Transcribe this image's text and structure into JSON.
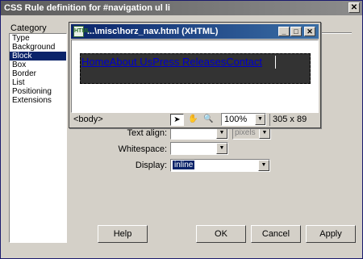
{
  "dialog": {
    "title": "CSS Rule definition for #navigation ul li",
    "close_glyph": "✕"
  },
  "category": {
    "label": "Category",
    "items": [
      "Type",
      "Background",
      "Block",
      "Box",
      "Border",
      "List",
      "Positioning",
      "Extensions"
    ],
    "selected": "Block"
  },
  "fields": {
    "text_align_label": "Text align:",
    "whitespace_label": "Whitespace:",
    "whitespace_value": "",
    "display_label": "Display:",
    "display_value": "inline",
    "text_align_unit": "pixels"
  },
  "buttons": {
    "help": "Help",
    "ok": "OK",
    "cancel": "Cancel",
    "apply": "Apply"
  },
  "preview": {
    "title": "...\\misc\\horz_nav.html (XHTML)",
    "nav_text": "HomeAbout UsPress ReleasesContact",
    "tag_selector": "<body>",
    "zoom": "100%",
    "dimensions": "305 x 89",
    "icon_text": "HTML",
    "minimize_glyph": "_",
    "maximize_glyph": "□",
    "close_glyph": "✕",
    "tools": {
      "select": "➤",
      "hand": "✋",
      "zoom": "🔍"
    }
  },
  "colors": {
    "selection": "#0a246a",
    "nav_bg": "#333333",
    "link": "#0000cc"
  }
}
